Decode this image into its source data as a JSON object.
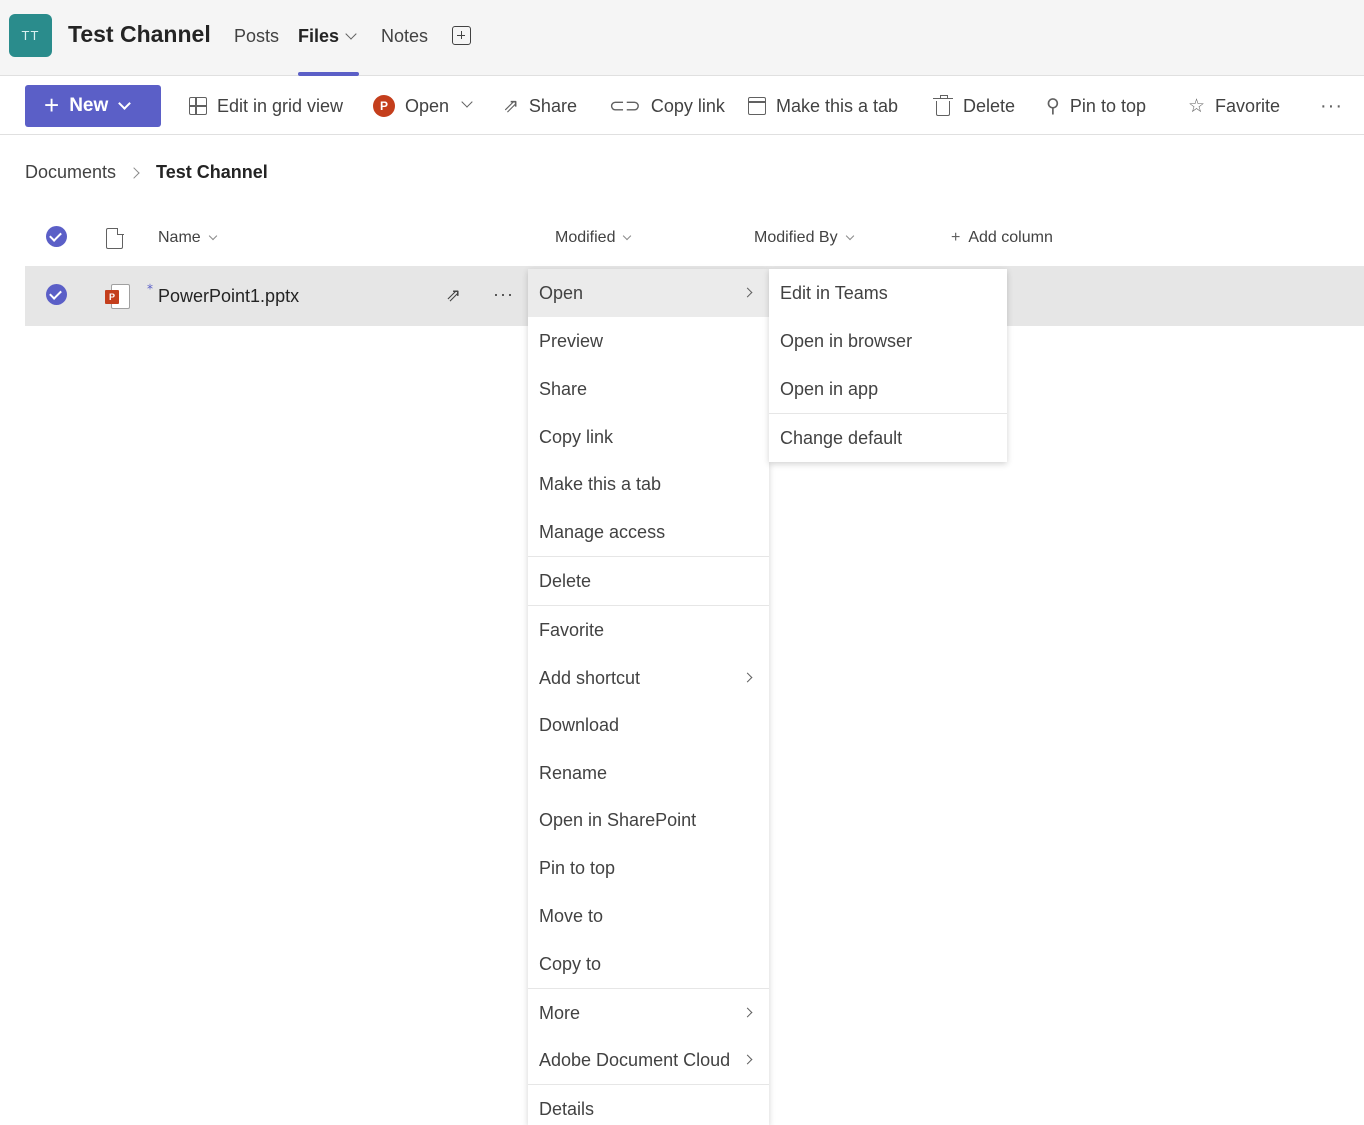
{
  "header": {
    "avatar_initials": "TT",
    "channel_title": "Test Channel",
    "tabs": [
      {
        "label": "Posts"
      },
      {
        "label": "Files"
      },
      {
        "label": "Notes"
      }
    ]
  },
  "toolbar": {
    "new_label": "New",
    "edit_grid_label": "Edit in grid view",
    "open_label": "Open",
    "share_label": "Share",
    "copy_link_label": "Copy link",
    "make_tab_label": "Make this a tab",
    "delete_label": "Delete",
    "pin_label": "Pin to top",
    "favorite_label": "Favorite",
    "more_label": "···"
  },
  "breadcrumb": {
    "root": "Documents",
    "current": "Test Channel"
  },
  "columns": {
    "name": "Name",
    "modified": "Modified",
    "modified_by": "Modified By",
    "add_column": "Add column"
  },
  "file": {
    "name": "PowerPoint1.pptx",
    "icon_badge": "P",
    "more_label": "···"
  },
  "context_menu": {
    "items": [
      {
        "label": "Open"
      },
      {
        "label": "Preview"
      },
      {
        "label": "Share"
      },
      {
        "label": "Copy link"
      },
      {
        "label": "Make this a tab"
      },
      {
        "label": "Manage access"
      },
      {
        "label": "Delete"
      },
      {
        "label": "Favorite"
      },
      {
        "label": "Add shortcut"
      },
      {
        "label": "Download"
      },
      {
        "label": "Rename"
      },
      {
        "label": "Open in SharePoint"
      },
      {
        "label": "Pin to top"
      },
      {
        "label": "Move to"
      },
      {
        "label": "Copy to"
      },
      {
        "label": "More"
      },
      {
        "label": "Adobe Document Cloud"
      },
      {
        "label": "Details"
      }
    ]
  },
  "open_submenu": {
    "items": [
      {
        "label": "Edit in Teams"
      },
      {
        "label": "Open in browser"
      },
      {
        "label": "Open in app"
      },
      {
        "label": "Change default"
      }
    ]
  },
  "colors": {
    "accent": "#5b5fc7",
    "avatar_bg": "#2a8c8c",
    "powerpoint": "#c43e1c",
    "selected_row": "#e6e6e6"
  }
}
